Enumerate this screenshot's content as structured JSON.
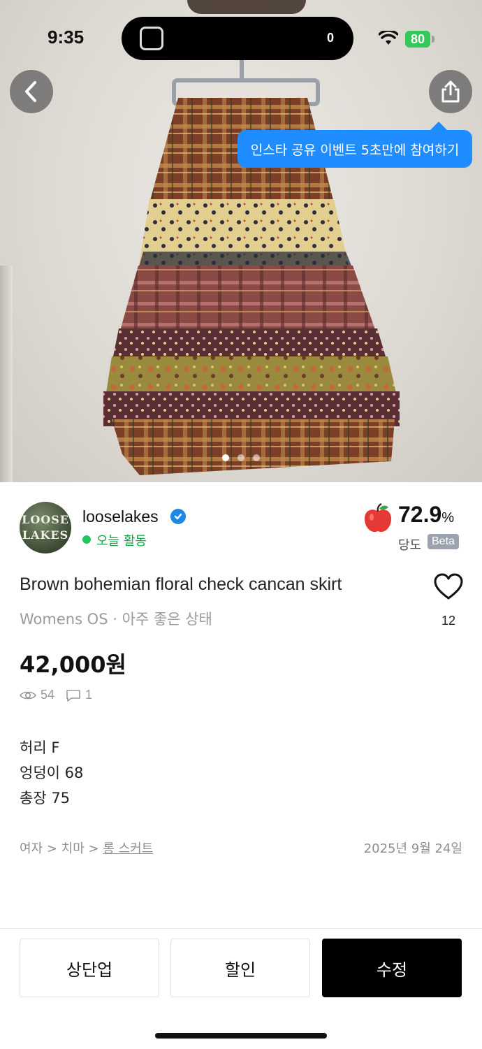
{
  "status_bar": {
    "time": "9:35",
    "island_count": "0",
    "battery": "80"
  },
  "image": {
    "slide_total": 3,
    "slide_active": 0
  },
  "tooltip": {
    "text": "인스타 공유 이벤트 5초만에 참여하기"
  },
  "seller": {
    "avatar_line1": "LOOSE",
    "avatar_line2": "LAKES",
    "name": "looselakes",
    "status": "오늘 활동",
    "score": "72.9",
    "score_unit": "%",
    "score_label": "당도",
    "beta": "Beta"
  },
  "product": {
    "title": "Brown bohemian floral check cancan skirt",
    "subtitle": "Womens OS · 아주 좋은 상태",
    "likes": "12",
    "price": "42,000원",
    "views": "54",
    "comments": "1",
    "description": [
      "허리 F",
      "엉덩이 68",
      "총장 75"
    ],
    "breadcrumb_prefix": "여자 > 치마 > ",
    "breadcrumb_link": "롱 스커트",
    "date": "2025년 9월 24일"
  },
  "actions": {
    "bump": "상단업",
    "discount": "할인",
    "edit": "수정"
  },
  "colors": {
    "accent_blue": "#1f8cff",
    "active_green": "#16a34a",
    "battery_green": "#34c759",
    "primary_button": "#000000"
  },
  "icons": [
    "back-arrow-icon",
    "share-icon",
    "verified-icon",
    "apple-icon",
    "heart-icon",
    "eye-icon",
    "comment-icon",
    "wifi-icon",
    "battery-icon",
    "screen-share-icon"
  ]
}
